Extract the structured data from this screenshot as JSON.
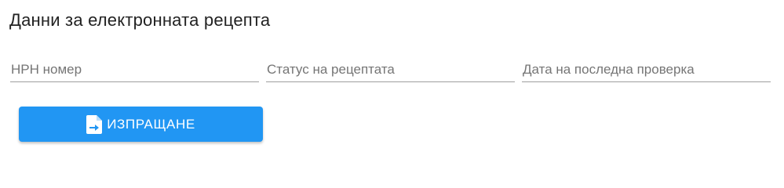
{
  "form": {
    "title": "Данни за електронната рецепта",
    "fields": [
      {
        "placeholder": "НРН номер",
        "value": ""
      },
      {
        "placeholder": "Статус на рецептата",
        "value": ""
      },
      {
        "placeholder": "Дата на последна проверка",
        "value": ""
      }
    ],
    "send_button": {
      "label": "ИЗПРАЩАНЕ",
      "icon": "file-send-icon"
    }
  },
  "colors": {
    "accent": "#2196f3",
    "button_text": "#ffffff",
    "underline": "#9e9e9e",
    "placeholder": "#757575"
  }
}
